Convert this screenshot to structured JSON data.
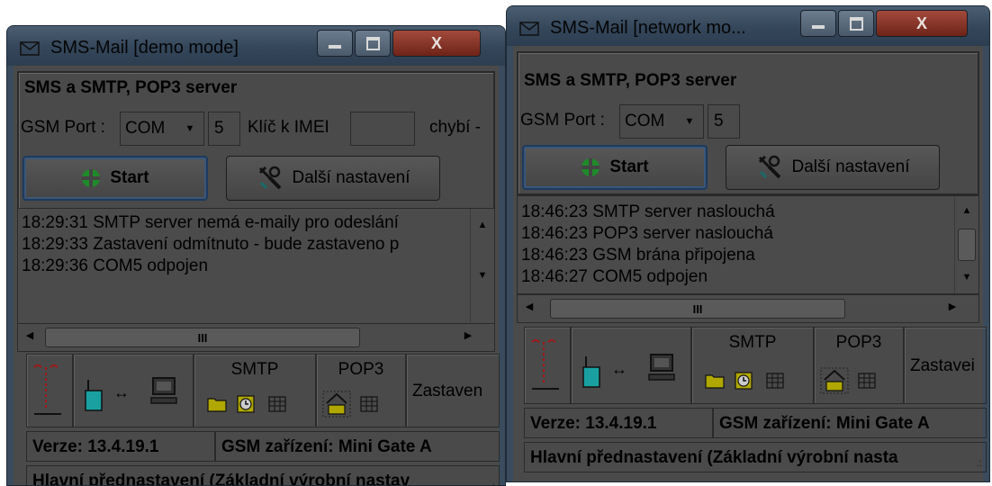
{
  "windows": [
    {
      "title": "SMS-Mail  [demo mode]",
      "group_title": "SMS a SMTP, POP3 server",
      "gsm_port_label": "GSM Port :",
      "port_type": "COM",
      "port_number": "5",
      "imei_label": "Klíč k IMEI",
      "imei_value": "",
      "missing_text": "chybí -",
      "start_label": "Start",
      "settings_label": "Další nastavení",
      "log": [
        "18:29:31  SMTP server nemá e-maily pro odeslání",
        "18:29:33  Zastavení odmítnuto - bude zastaveno p",
        "18:29:36  COM5 odpojen"
      ],
      "scroll_label": "III",
      "smtp_label": "SMTP",
      "pop3_label": "POP3",
      "stop_label": "Zastaven",
      "version": "Verze: 13.4.19.1",
      "device": "GSM zařízení: Mini Gate A",
      "preset": "Hlavní přednastavení (Základní výrobní nastav"
    },
    {
      "title": "SMS-Mail  [network mo...",
      "group_title": "SMS a SMTP, POP3 server",
      "gsm_port_label": "GSM Port :",
      "port_type": "COM",
      "port_number": "5",
      "start_label": "Start",
      "settings_label": "Další nastavení",
      "log": [
        "18:46:23  SMTP server naslouchá",
        "18:46:23  POP3 server naslouchá",
        "18:46:23  GSM brána připojena",
        "18:46:27  COM5 odpojen"
      ],
      "scroll_label": "III",
      "smtp_label": "SMTP",
      "pop3_label": "POP3",
      "stop_label": "Zastavei",
      "version": "Verze: 13.4.19.1",
      "device": "GSM zařízení: Mini Gate A",
      "preset": "Hlavní přednastavení (Základní výrobní nasta"
    }
  ],
  "icons": {
    "title": "envelope-icon",
    "minimize": "minimize-icon",
    "maximize": "maximize-icon",
    "close": "close-icon",
    "start": "green-cross-icon",
    "settings": "tools-icon",
    "modem": "modem-icon",
    "computer": "computer-icon",
    "folder": "folder-icon",
    "clock": "clock-icon",
    "grid": "grid-icon",
    "home": "home-icon"
  },
  "colors": {
    "title_bar": "#3a4c60",
    "window_bg": "#4a4a4a",
    "close_button": "#8a3428",
    "start_icon": "#1f8a2a",
    "modem_icon": "#1aa0a0",
    "folder_icon": "#b0a800",
    "signal_icon": "#a01818"
  }
}
